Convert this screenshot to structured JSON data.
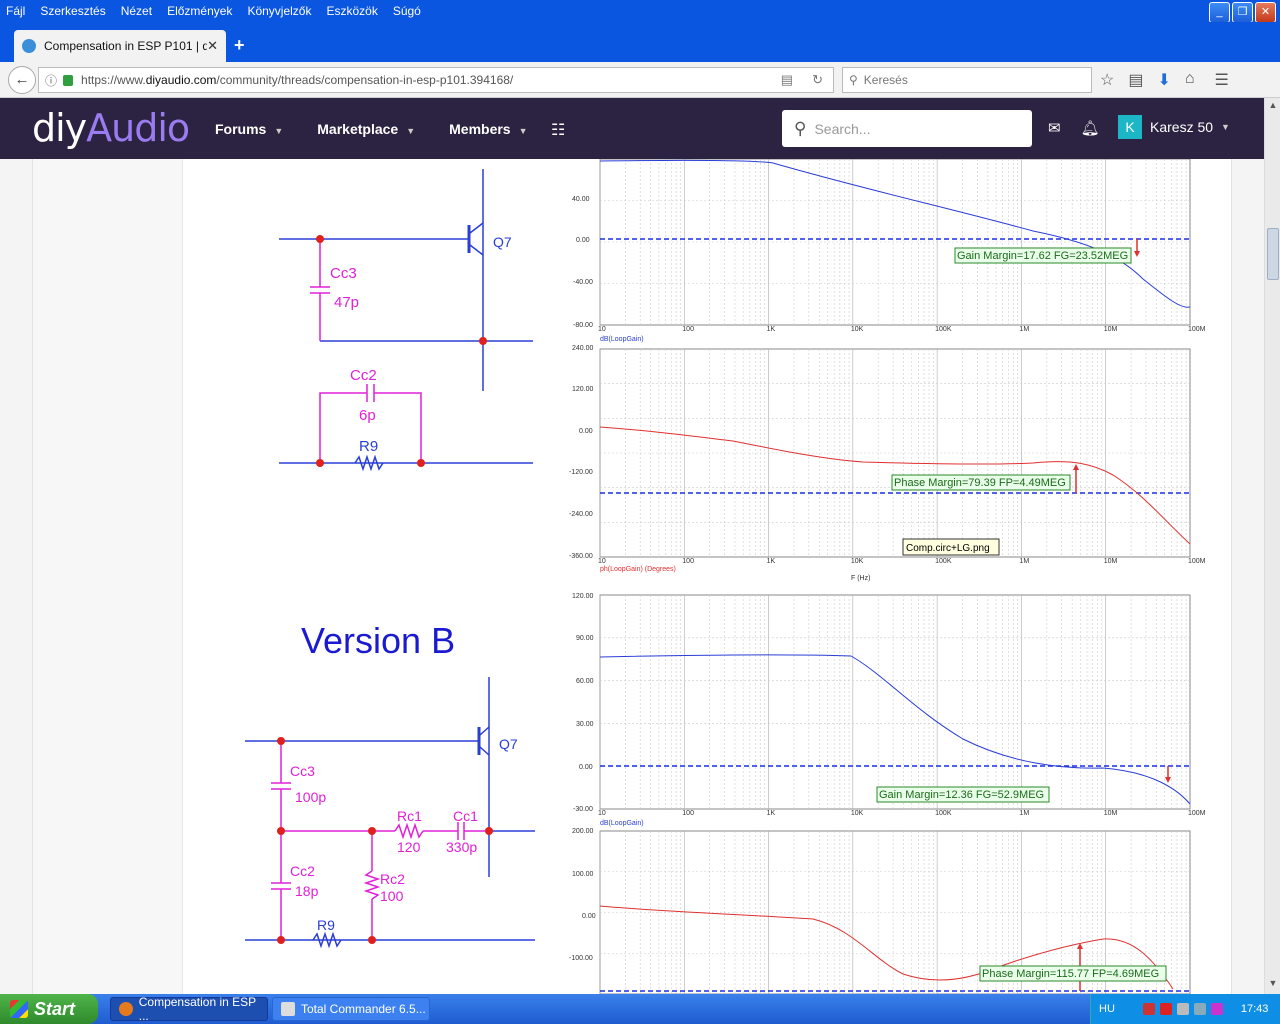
{
  "menu": [
    "Fájl",
    "Szerkesztés",
    "Nézet",
    "Előzmények",
    "Könyvjelzők",
    "Eszközök",
    "Súgó"
  ],
  "tab": {
    "title": "Compensation in ESP P101 | d..."
  },
  "address": {
    "url_prefix": "https://www.",
    "url_domain": "diyaudio.com",
    "url_path": "/community/threads/compensation-in-esp-p101.394168/"
  },
  "browser_search": {
    "placeholder": "Keresés"
  },
  "site": {
    "logo_diy": "diy",
    "logo_audio": "Audio",
    "nav": [
      "Forums",
      "Marketplace",
      "Members"
    ],
    "search_placeholder": "Search...",
    "user_initial": "K",
    "user_name": "Karesz 50"
  },
  "schematic_a": {
    "q": "Q7",
    "cc3": "Cc3",
    "cc3_val": "47p",
    "cc2": "Cc2",
    "cc2_val": "6p",
    "r9": "R9"
  },
  "schematic_b": {
    "title": "Version B",
    "q": "Q7",
    "cc3": "Cc3",
    "cc3_val": "100p",
    "cc2": "Cc2",
    "cc2_val": "18p",
    "rc1": "Rc1",
    "rc1_val": "120",
    "cc1": "Cc1",
    "cc1_val": "330p",
    "rc2": "Rc2",
    "rc2_val": "100",
    "r9": "R9"
  },
  "plots": {
    "x_ticks": [
      "10",
      "100",
      "1K",
      "10K",
      "100K",
      "1M",
      "10M",
      "100M"
    ],
    "a_gain": {
      "yticks": [
        "40.00",
        "0.00",
        "-40.00",
        "-80.00"
      ],
      "ylabel": "dB(LoopGain)",
      "annotation": "Gain Margin=17.62 FG=23.52MEG"
    },
    "a_phase": {
      "yticks": [
        "240.00",
        "120.00",
        "0.00",
        "-120.00",
        "-240.00",
        "-360.00"
      ],
      "ylabel": "ph(LoopGain) (Degrees)",
      "annotation": "Phase Margin=79.39 FP=4.49MEG",
      "xlabel": "F (Hz)"
    },
    "tooltip": "Comp.circ+LG.png",
    "b_gain": {
      "yticks": [
        "120.00",
        "90.00",
        "60.00",
        "30.00",
        "0.00",
        "-30.00"
      ],
      "ylabel": "dB(LoopGain)",
      "annotation": "Gain Margin=12.36 FG=52.9MEG"
    },
    "b_phase": {
      "yticks": [
        "200.00",
        "100.00",
        "0.00",
        "-100.00"
      ],
      "annotation": "Phase Margin=115.77 FP=4.69MEG"
    },
    "gain_color": "#2a3ed6",
    "phase_color": "#e03030"
  },
  "taskbar": {
    "start": "Start",
    "tasks": [
      "Compensation in ESP ...",
      "Total Commander 6.5..."
    ],
    "lang": "HU",
    "clock": "17:43"
  }
}
